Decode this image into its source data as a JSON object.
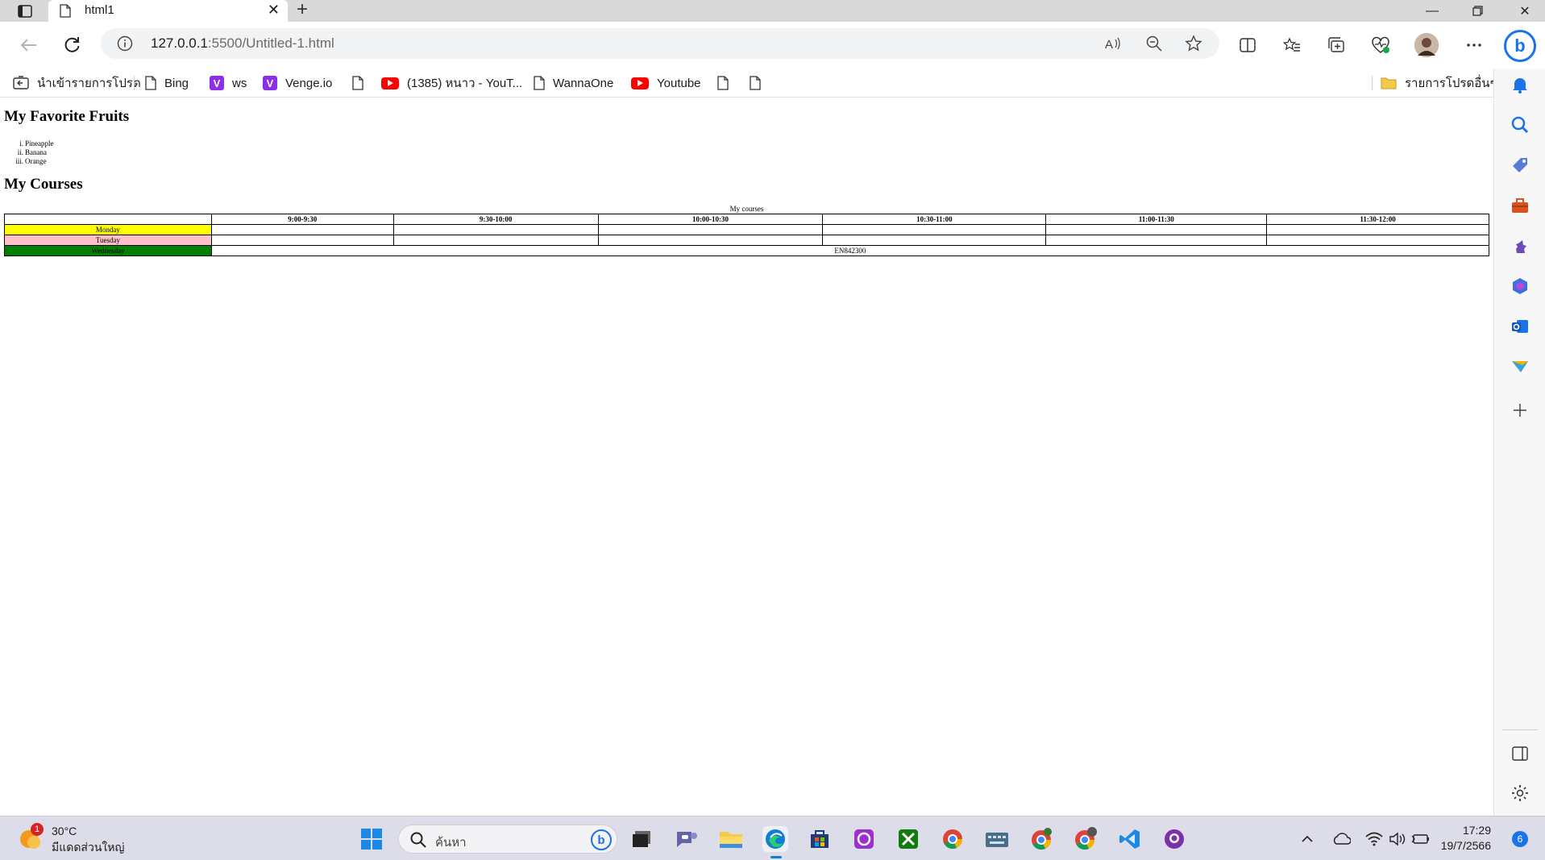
{
  "browser": {
    "tab_title": "html1",
    "address_host": "127.0.0.1",
    "address_rest": ":5500/Untitled-1.html"
  },
  "favorites": {
    "import_label": "นำเข้ารายการโปรด",
    "items": [
      {
        "label": "Bing",
        "icon": "page-icon"
      },
      {
        "label": "ws",
        "icon": "v-icon"
      },
      {
        "label": "Venge.io",
        "icon": "v-icon"
      },
      {
        "label": "",
        "icon": "page-icon"
      },
      {
        "label": "(1385) หนาว - YouT...",
        "icon": "youtube-icon"
      },
      {
        "label": "WannaOne",
        "icon": "page-icon"
      },
      {
        "label": "Youtube",
        "icon": "youtube-icon"
      }
    ],
    "other_folder": "รายการโปรดอื่นๆ"
  },
  "page": {
    "fruits_heading": "My Favorite Fruits",
    "fruits": [
      {
        "num": "i.",
        "name": "Pineapple"
      },
      {
        "num": "ii.",
        "name": "Banana"
      },
      {
        "num": "iii.",
        "name": "Orange"
      }
    ],
    "courses_heading": "My Courses",
    "table_caption": "My courses",
    "time_slots": [
      "9:00-9:30",
      "9:30-10:00",
      "10:00-10:30",
      "10:30-11:00",
      "11:00-11:30",
      "11:30-12:00"
    ],
    "days": [
      {
        "name": "Monday",
        "color": "#ffff00"
      },
      {
        "name": "Tuesday",
        "color": "#ffc0cb"
      },
      {
        "name": "Wednesday",
        "color": "#008000"
      }
    ],
    "wednesday_course": "EN842300"
  },
  "taskbar": {
    "temperature": "30°C",
    "weather_desc": "มีแดดส่วนใหญ่",
    "weather_badge": "1",
    "search_placeholder": "ค้นหา",
    "time": "17:29",
    "date": "19/7/2566",
    "notification_count": "6"
  }
}
